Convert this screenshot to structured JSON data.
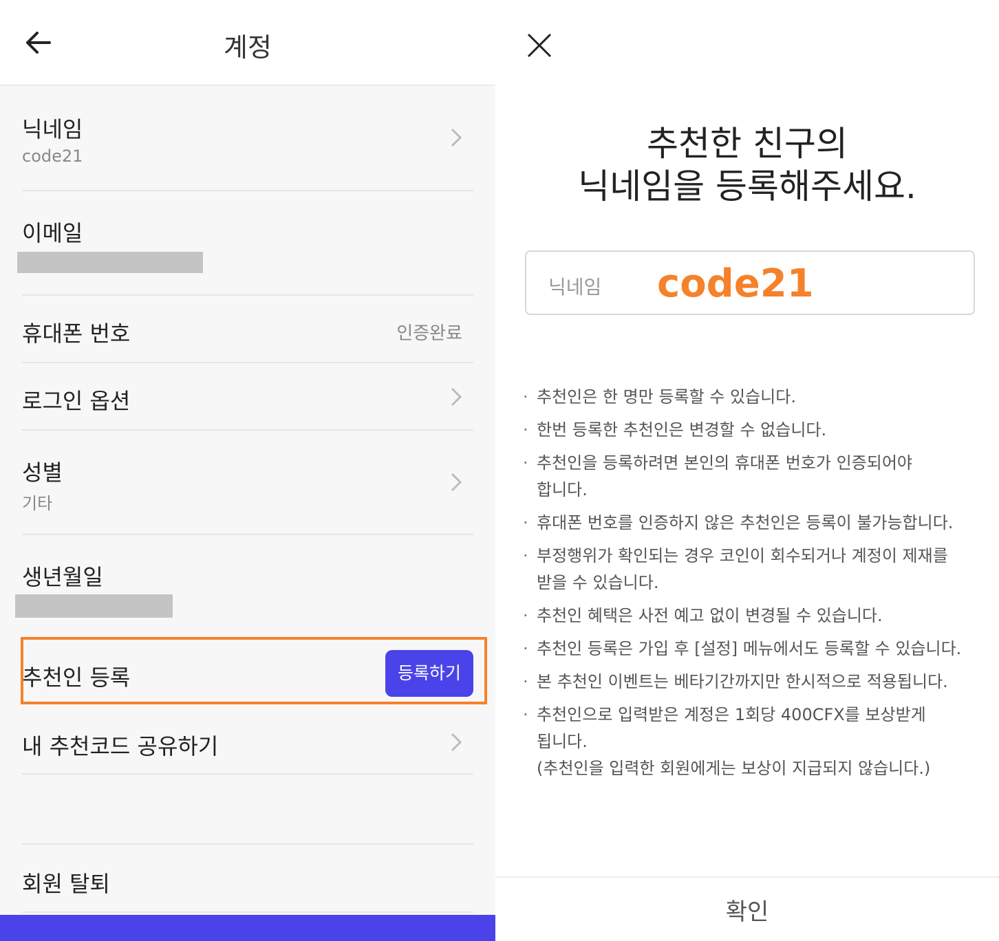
{
  "left": {
    "header": {
      "title": "계정",
      "back_icon": "arrow-left-icon"
    },
    "rows": {
      "nickname": {
        "label": "닉네임",
        "value": "code21"
      },
      "email": {
        "label": "이메일"
      },
      "phone": {
        "label": "휴대폰 번호",
        "status": "인증완료"
      },
      "login": {
        "label": "로그인 옵션"
      },
      "gender": {
        "label": "성별",
        "value": "기타"
      },
      "birthday": {
        "label": "생년월일"
      },
      "referrer": {
        "label": "추천인 등록",
        "button": "등록하기"
      },
      "share": {
        "label": "내 추천코드 공유하기"
      },
      "withdraw": {
        "label": "회원 탈퇴"
      }
    }
  },
  "right": {
    "headline": {
      "line1": "추천한 친구의",
      "line2": "닉네임을 등록해주세요."
    },
    "input": {
      "label": "닉네임",
      "value": "code21"
    },
    "notes": [
      "추천인은 한 명만 등록할 수 있습니다.",
      "한번 등록한 추천인은 변경할 수 없습니다.",
      "추천인을 등록하려면 본인의 휴대폰 번호가 인증되어야\n합니다.",
      "휴대폰 번호를 인증하지 않은 추천인은 등록이 불가능합니다.",
      "부정행위가 확인되는 경우 코인이 회수되거나 계정이 제재를\n받을 수 있습니다.",
      "추천인 혜택은 사전 예고 없이 변경될 수 있습니다.",
      "추천인 등록은 가입 후 [설정] 메뉴에서도 등록할 수 있습니다.",
      "본 추천인 이벤트는 베타기간까지만 한시적으로 적용됩니다.",
      "추천인으로 입력받은 계정은 1회당 400CFX를 보상받게\n됩니다.\n(추천인을 입력한 회원에게는 보상이 지급되지 않습니다.)"
    ],
    "confirm": "확인"
  },
  "colors": {
    "accent": "#4a43ea",
    "highlight": "#f5822a"
  }
}
